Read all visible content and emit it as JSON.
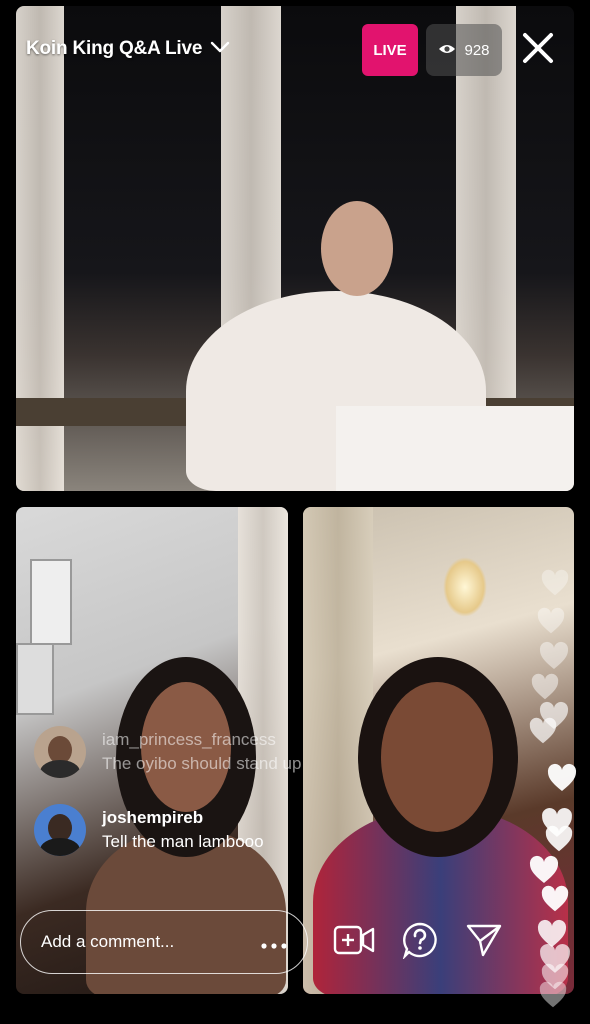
{
  "stream": {
    "title": "Koin King Q&A Live",
    "live_label": "LIVE",
    "viewer_count": "928"
  },
  "comments": [
    {
      "user": "iam_princess_francess",
      "message": "The oyibo should stand up"
    },
    {
      "user": "joshempireb",
      "message": "Tell the man lambooo"
    }
  ],
  "comment_input": {
    "placeholder": "Add a comment..."
  },
  "icons": {
    "title_dropdown": "chevron-down-icon",
    "viewers": "eye-icon",
    "close": "close-icon",
    "more": "more-dots-icon",
    "add_guest": "add-video-icon",
    "question": "question-icon",
    "share": "send-icon",
    "like": "heart-icon"
  },
  "colors": {
    "live_badge": "#e2136e"
  }
}
